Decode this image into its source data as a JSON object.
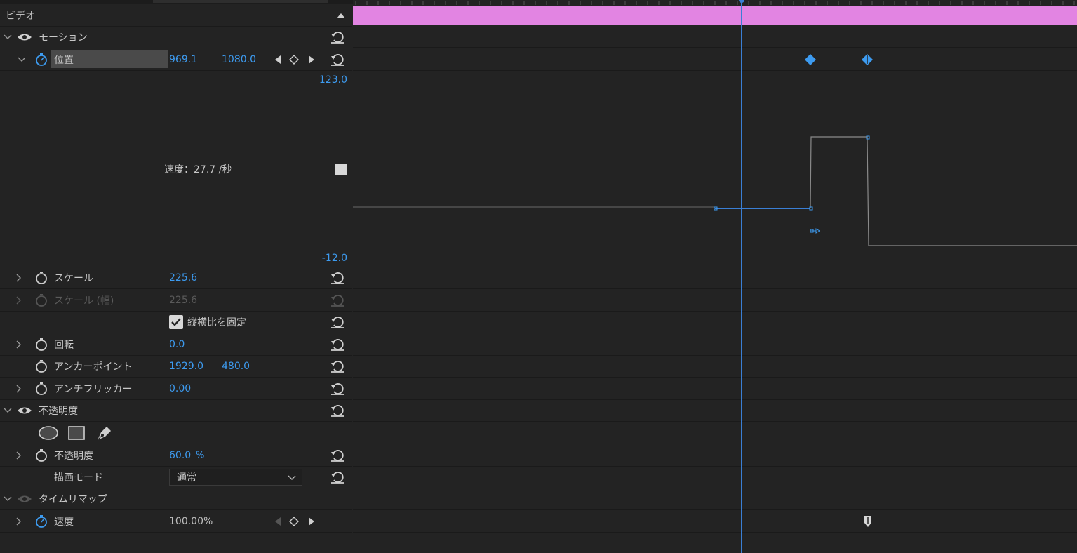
{
  "section": {
    "video_title": "ビデオ"
  },
  "motion": {
    "label": "モーション",
    "position": {
      "label": "位置",
      "x": "969.1",
      "y": "1080.0"
    },
    "graph": {
      "max": "123.0",
      "min": "-12.0",
      "speed_text": "速度：27.7 /秒"
    },
    "scale": {
      "label": "スケール",
      "value": "225.6"
    },
    "scale_width": {
      "label": "スケール (幅)",
      "value": "225.6"
    },
    "uniform_scale": {
      "label": "縦横比を固定",
      "checked": true
    },
    "rotation": {
      "label": "回転",
      "value": "0.0"
    },
    "anchor": {
      "label": "アンカーポイント",
      "x": "1929.0",
      "y": "480.0"
    },
    "antiflicker": {
      "label": "アンチフリッカー",
      "value": "0.00"
    }
  },
  "opacity": {
    "label": "不透明度",
    "opacity_prop": {
      "label": "不透明度",
      "value": "60.0",
      "unit": "%"
    },
    "blend_mode": {
      "label": "描画モード",
      "value": "通常"
    }
  },
  "time_remap": {
    "label": "タイムリマップ",
    "speed": {
      "label": "速度",
      "value": "100.00%"
    }
  },
  "colors": {
    "accent": "#3d9bf0",
    "clip": "#e284e2",
    "playhead": "#3a7fd5"
  }
}
